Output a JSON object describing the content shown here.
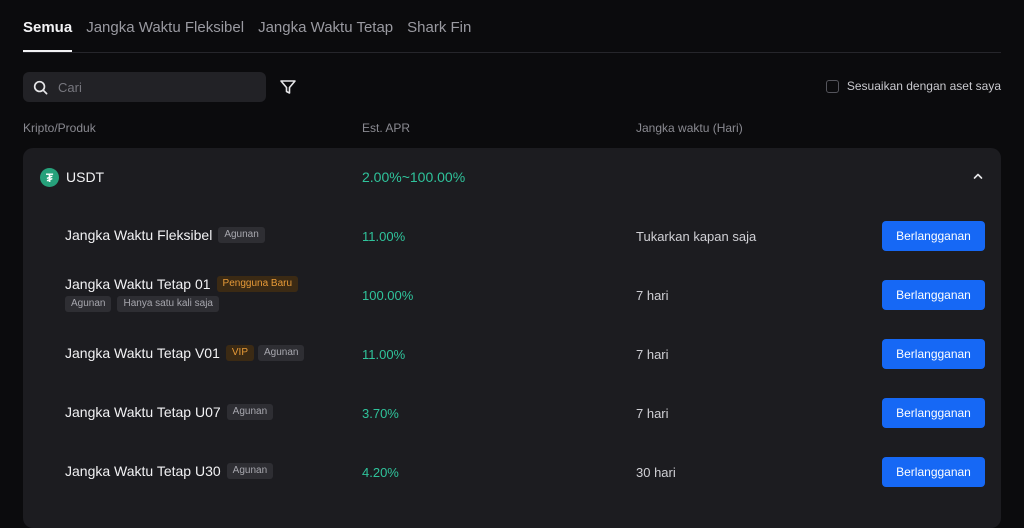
{
  "tabs": [
    {
      "label": "Semua",
      "active": true
    },
    {
      "label": "Jangka Waktu Fleksibel",
      "active": false
    },
    {
      "label": "Jangka Waktu Tetap",
      "active": false
    },
    {
      "label": "Shark Fin",
      "active": false
    }
  ],
  "search": {
    "placeholder": "Cari",
    "value": ""
  },
  "match_assets": {
    "label": "Sesuaikan dengan aset saya",
    "checked": false
  },
  "columns": {
    "product": "Kripto/Produk",
    "apr": "Est. APR",
    "term": "Jangka waktu (Hari)"
  },
  "coin": {
    "name": "USDT",
    "apr_range": "2.00%~100.00%",
    "logo_glyph": "₮",
    "logo_color": "#26a17b"
  },
  "products": [
    {
      "name": "Jangka Waktu Fleksibel",
      "tags": [
        "Agunan"
      ],
      "sub_tags": [],
      "apr": "11.00%",
      "term": "Tukarkan kapan saja",
      "button": "Berlangganan"
    },
    {
      "name": "Jangka Waktu Tetap 01",
      "tags": [
        "Pengguna Baru"
      ],
      "sub_tags": [
        "Agunan",
        "Hanya satu kali saja"
      ],
      "apr": "100.00%",
      "term": "7 hari",
      "button": "Berlangganan"
    },
    {
      "name": "Jangka Waktu Tetap V01",
      "tags": [
        "VIP",
        "Agunan"
      ],
      "sub_tags": [],
      "apr": "11.00%",
      "term": "7 hari",
      "button": "Berlangganan"
    },
    {
      "name": "Jangka Waktu Tetap U07",
      "tags": [
        "Agunan"
      ],
      "sub_tags": [],
      "apr": "3.70%",
      "term": "7 hari",
      "button": "Berlangganan"
    },
    {
      "name": "Jangka Waktu Tetap U30",
      "tags": [
        "Agunan"
      ],
      "sub_tags": [],
      "apr": "4.20%",
      "term": "30 hari",
      "button": "Berlangganan"
    }
  ],
  "colors": {
    "accent": "#1668f5",
    "apr": "#2fc39b",
    "badge_orange": "#e79a38",
    "panel": "#1c1c20",
    "background": "#0b0b0d"
  },
  "icons": {
    "search": "search-icon",
    "filter": "filter-icon",
    "collapse": "chevron-up-icon"
  }
}
